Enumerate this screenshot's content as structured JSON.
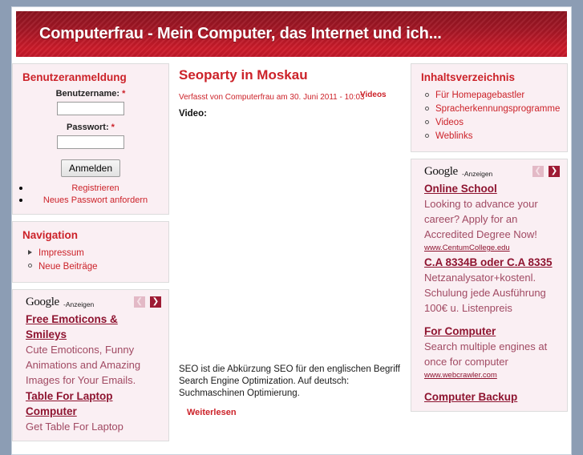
{
  "site": {
    "title": "Computerfrau - Mein Computer, das Internet und ich...",
    "header_color": "#a61726",
    "accent_color": "#cc2229",
    "block_bg": "#faeff3",
    "page_bg": "#8c9db4"
  },
  "login_block": {
    "title": "Benutzeranmeldung",
    "username_label": "Benutzername:",
    "username_value": "",
    "password_label": "Passwort:",
    "password_value": "",
    "required_marker": "*",
    "submit_label": "Anmelden",
    "links": [
      {
        "label": "Registrieren"
      },
      {
        "label": "Neues Passwort anfordern"
      }
    ]
  },
  "navigation_block": {
    "title": "Navigation",
    "items": [
      {
        "label": "Impressum",
        "bullet": "triangle-right-icon"
      },
      {
        "label": "Neue Beiträge",
        "bullet": "circle-bullet-icon"
      }
    ]
  },
  "toc_block": {
    "title": "Inhaltsverzeichnis",
    "items": [
      {
        "label": "Für Homepagebastler"
      },
      {
        "label": "Spracherkennungsprogramme"
      },
      {
        "label": "Videos"
      },
      {
        "label": "Weblinks"
      }
    ]
  },
  "ads_left": {
    "brand": "Google",
    "brand_suffix": "-Anzeigen",
    "prev_icon": "chevron-left-icon",
    "next_icon": "chevron-right-icon",
    "ads": [
      {
        "title": "Free Emoticons & Smileys",
        "text": "Cute Emoticons, Funny Animations and Amazing Images for Your Emails.",
        "url": ""
      },
      {
        "title": "Table For Laptop Computer",
        "text": "Get Table For Laptop",
        "url": ""
      }
    ]
  },
  "ads_right": {
    "brand": "Google",
    "brand_suffix": "-Anzeigen",
    "prev_icon": "chevron-left-icon",
    "next_icon": "chevron-right-icon",
    "ads": [
      {
        "title": "Online School",
        "text": "Looking to advance your career? Apply for an Accredited Degree Now!",
        "url": "www.CentumCollege.edu"
      },
      {
        "title": "C.A 8334B oder C.A 8335",
        "text": "Netzanalysator+kostenl. Schulung jede Ausführung 100€ u. Listenpreis",
        "url": ""
      },
      {
        "title": "For Computer",
        "text": "Search multiple engines at once for computer",
        "url": "www.webcrawler.com"
      },
      {
        "title": "Computer Backup",
        "text": "",
        "url": ""
      }
    ]
  },
  "node": {
    "title": "Seoparty in Moskau",
    "submitted": "Verfasst von Computerfrau am 30. Juni 2011 - 10:03",
    "terms": "Videos",
    "video_label": "Video:",
    "teaser": "SEO ist die Abkürzung SEO für den englischen Begriff Search Engine Optimization. Auf deutsch: Suchmaschinen Optimierung.",
    "read_more": "Weiterlesen"
  }
}
